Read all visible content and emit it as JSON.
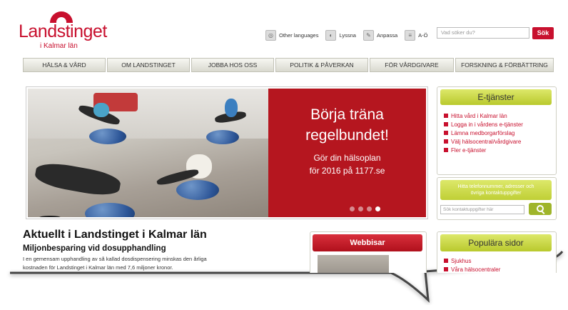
{
  "logo": {
    "name": "Landstinget",
    "sub": "i Kalmar län"
  },
  "toollinks": [
    {
      "icon": "globe-icon",
      "label": "Other languages"
    },
    {
      "icon": "speaker-icon",
      "label": "Lyssna"
    },
    {
      "icon": "settings-icon",
      "label": "Anpassa"
    },
    {
      "icon": "list-icon",
      "label": "A-Ö"
    }
  ],
  "search": {
    "placeholder": "Vad söker du?",
    "button": "Sök"
  },
  "nav": [
    "HÄLSA & VÅRD",
    "OM LANDSTINGET",
    "JOBBA HOS OSS",
    "POLITIK & PÅVERKAN",
    "FÖR VÅRDGIVARE",
    "FORSKNING & FÖRBÄTTRING"
  ],
  "banner": {
    "headline1": "Börja träna",
    "headline2": "regelbundet!",
    "text1": "Gör din hälsoplan",
    "text2": "för 2016 på 1177.se",
    "slides": 4,
    "active_slide": 4
  },
  "etjanster": {
    "title": "E-tjänster",
    "items": [
      "Hitta vård i Kalmar län",
      "Logga in i vårdens e-tjänster",
      "Lämna medborgarförslag",
      "Välj hälsocentral/vårdgivare",
      "Fler e-tjänster"
    ]
  },
  "contact": {
    "title1": "Hitta telefonnummer, adresser och",
    "title2": "övriga kontaktuppgifter",
    "placeholder": "Sök kontaktuppgifter här"
  },
  "news": {
    "title": "Aktuellt i Landstinget i Kalmar län",
    "headline": "Miljonbesparing vid dosupphandling",
    "text1": "I en gemensam upphandling av så kallad dosdispensering minskas den årliga",
    "text2": "kostnaden för Landstinget i Kalmar län med 7,6 miljoner kronor."
  },
  "webbisar": {
    "title": "Webbisar"
  },
  "popular": {
    "title": "Populära sidor",
    "items": [
      "Sjukhus",
      "Våra hälsocentraler"
    ]
  }
}
